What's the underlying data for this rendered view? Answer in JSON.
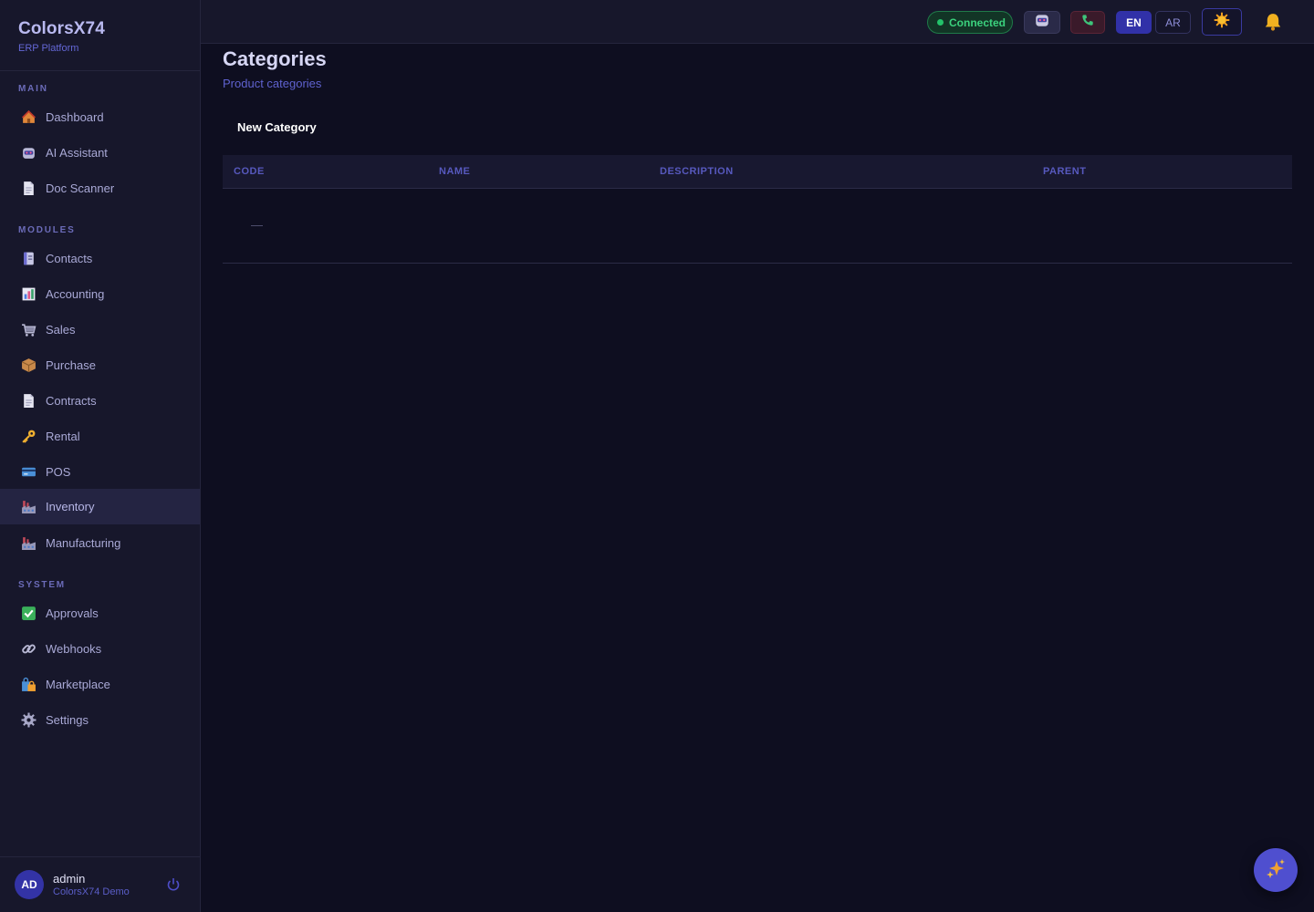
{
  "brand": {
    "name": "ColorsX74",
    "subtitle": "ERP Platform"
  },
  "sidebar": {
    "sections": [
      {
        "label": "MAIN",
        "items": [
          {
            "label": "Dashboard",
            "icon": "house-icon"
          },
          {
            "label": "AI Assistant",
            "icon": "robot-icon"
          },
          {
            "label": "Doc Scanner",
            "icon": "document-icon"
          }
        ]
      },
      {
        "label": "MODULES",
        "items": [
          {
            "label": "Contacts",
            "icon": "contact-book-icon"
          },
          {
            "label": "Accounting",
            "icon": "bar-chart-icon"
          },
          {
            "label": "Sales",
            "icon": "cart-icon"
          },
          {
            "label": "Purchase",
            "icon": "package-icon"
          },
          {
            "label": "Contracts",
            "icon": "document-icon"
          },
          {
            "label": "Rental",
            "icon": "key-icon"
          },
          {
            "label": "POS",
            "icon": "credit-card-icon"
          },
          {
            "label": "Inventory",
            "icon": "factory-icon",
            "active": true
          },
          {
            "label": "Manufacturing",
            "icon": "factory-icon"
          }
        ]
      },
      {
        "label": "SYSTEM",
        "items": [
          {
            "label": "Approvals",
            "icon": "check-box-icon"
          },
          {
            "label": "Webhooks",
            "icon": "link-icon"
          },
          {
            "label": "Marketplace",
            "icon": "shopping-bags-icon"
          },
          {
            "label": "Settings",
            "icon": "gear-icon"
          }
        ]
      }
    ],
    "user": {
      "initials": "AD",
      "name": "admin",
      "org": "ColorsX74 Demo"
    }
  },
  "topbar": {
    "status": "Connected",
    "lang_en": "EN",
    "lang_ar": "AR",
    "colors": {
      "connected": "#3bd17d",
      "accent": "#3131a8"
    }
  },
  "page": {
    "title": "Categories",
    "subtitle": "Product categories",
    "new_button": "New Category",
    "columns": [
      "CODE",
      "NAME",
      "DESCRIPTION",
      "PARENT"
    ],
    "empty_placeholder": "—"
  }
}
